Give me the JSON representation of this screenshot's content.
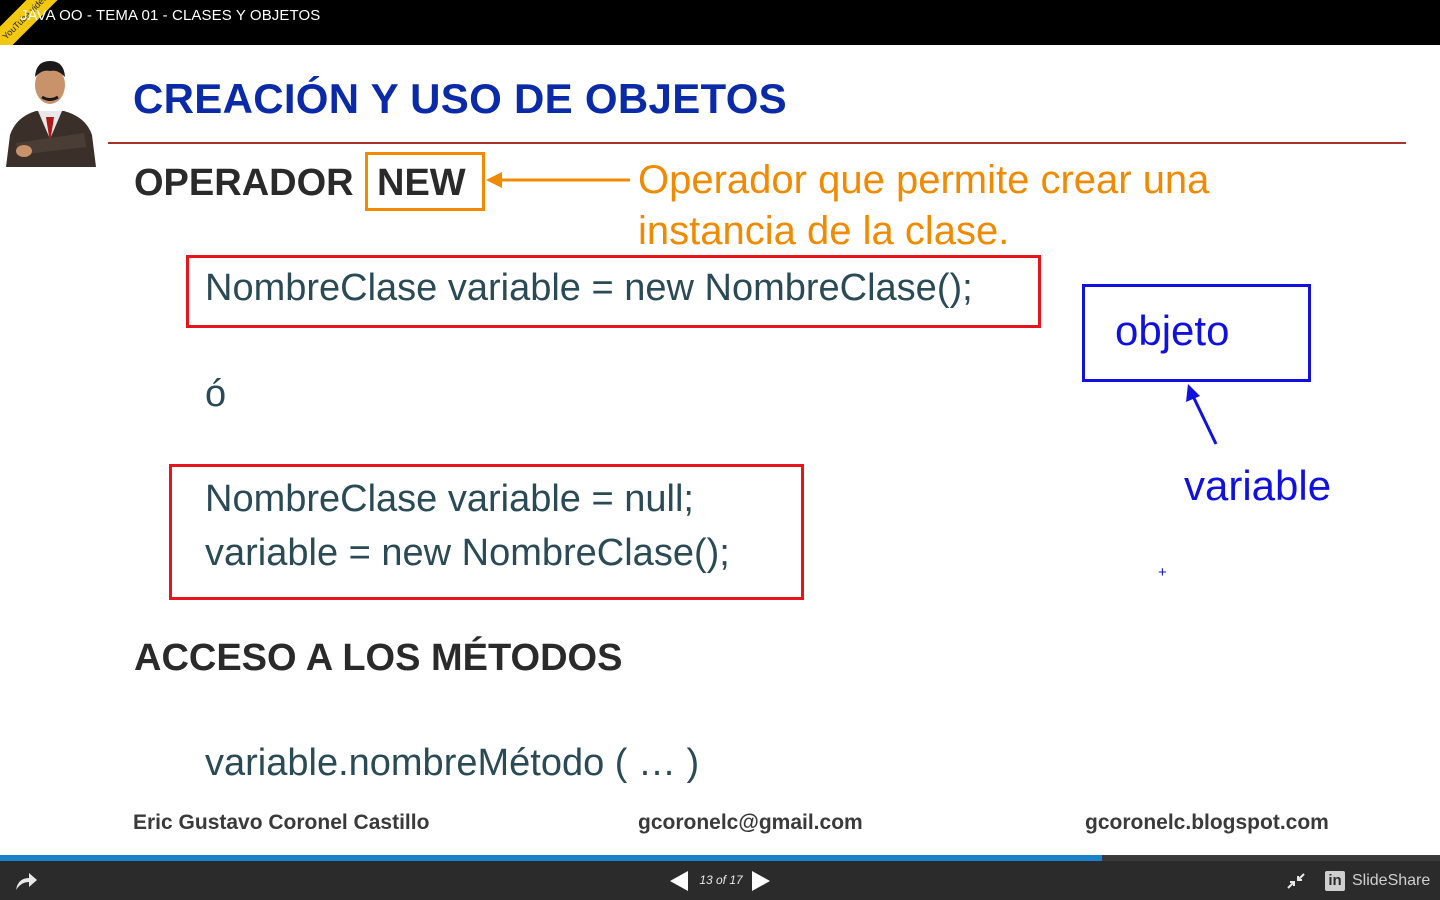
{
  "window": {
    "title": "JAVA OO - TEMA 01 - CLASES Y OBJETOS",
    "ribbon_text": "YouTube video"
  },
  "slide": {
    "heading": "CREACIÓN Y USO DE OBJETOS",
    "operator_label": "OPERADOR",
    "operator_keyword": "NEW",
    "operator_note": "Operador que permite crear una instancia de la clase.",
    "code_line_1": "NombreClase variable = new NombreClase();",
    "or_text": "ó",
    "code_line_2a": "NombreClase variable = null;",
    "code_line_2b": "variable = new NombreClase();",
    "object_label": "objeto",
    "variable_label": "variable",
    "cursor_mark": "+",
    "methods_heading": "ACCESO A LOS MÉTODOS",
    "method_call": "variable.nombreMétodo ( … )",
    "footer_author": "Eric Gustavo Coronel Castillo",
    "footer_email": "gcoronelc@gmail.com",
    "footer_blog": "gcoronelc.blogspot.com"
  },
  "player": {
    "page_counter": "13 of 17",
    "progress_fraction": 0.765,
    "brand_icon_text": "in",
    "brand_name": "SlideShare",
    "icons": [
      "share-icon",
      "prev-arrow-icon",
      "next-arrow-icon",
      "exit-fullscreen-icon",
      "linkedin-icon"
    ]
  },
  "colors": {
    "heading": "#0a2aa8",
    "rule": "#a8312a",
    "operator_highlight": "#f08a00",
    "code_box": "#e8141c",
    "annotation_blue": "#1010e0",
    "progress": "#1a82c8"
  }
}
